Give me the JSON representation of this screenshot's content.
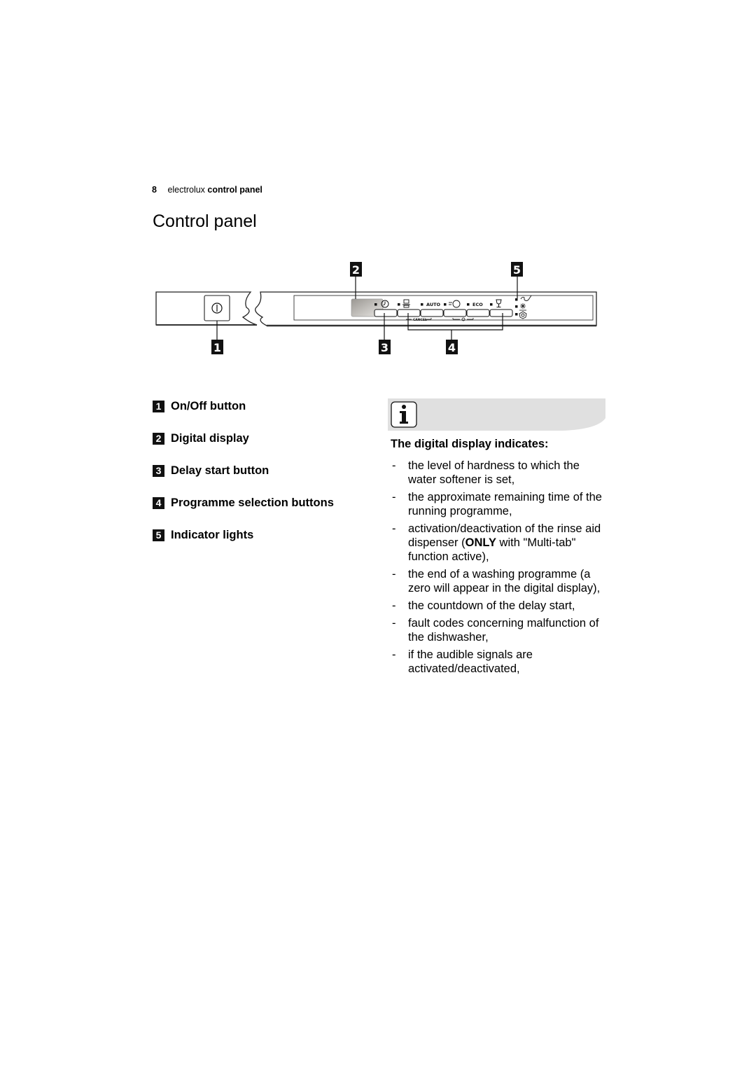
{
  "header": {
    "page_number": "8",
    "brand": "electrolux",
    "section": "control panel"
  },
  "title": "Control panel",
  "diagram": {
    "callouts": [
      "1",
      "2",
      "3",
      "4",
      "5"
    ],
    "panel_labels": {
      "auto": "AUTO",
      "eco": "ECO",
      "cancel": "CANCEL"
    },
    "icons": {
      "power": "power-icon",
      "delay": "clock-icon",
      "pots": "pots-pans-icon",
      "auto": "auto-label",
      "quick": "quick-wash-icon",
      "eco": "eco-label",
      "glass": "wine-glass-icon",
      "indicators": [
        "rinse-aid-icon",
        "salt-icon",
        "multitab-icon"
      ]
    }
  },
  "legend": [
    {
      "number": "1",
      "label": "On/Off button"
    },
    {
      "number": "2",
      "label": "Digital display"
    },
    {
      "number": "3",
      "label": "Delay start button"
    },
    {
      "number": "4",
      "label": "Programme selection buttons"
    },
    {
      "number": "5",
      "label": "Indicator lights"
    }
  ],
  "info": {
    "icon": "info-icon",
    "heading": "The digital display indicates:",
    "items": [
      {
        "text": "the level of hardness to which the water softener is set,"
      },
      {
        "text": "the approximate remaining time of the running programme,"
      },
      {
        "pre": "activation/deactivation of the rinse aid dispenser (",
        "bold": "ONLY",
        "post": " with \"Multi-tab\" function active),"
      },
      {
        "text": "the end of a washing programme (a zero will appear in the digital display),"
      },
      {
        "text": "the countdown of the delay start,"
      },
      {
        "text": "fault codes concerning malfunction of the dishwasher,"
      },
      {
        "text": "if the audible signals are activated/deactivated,"
      }
    ],
    "dash": "-"
  }
}
